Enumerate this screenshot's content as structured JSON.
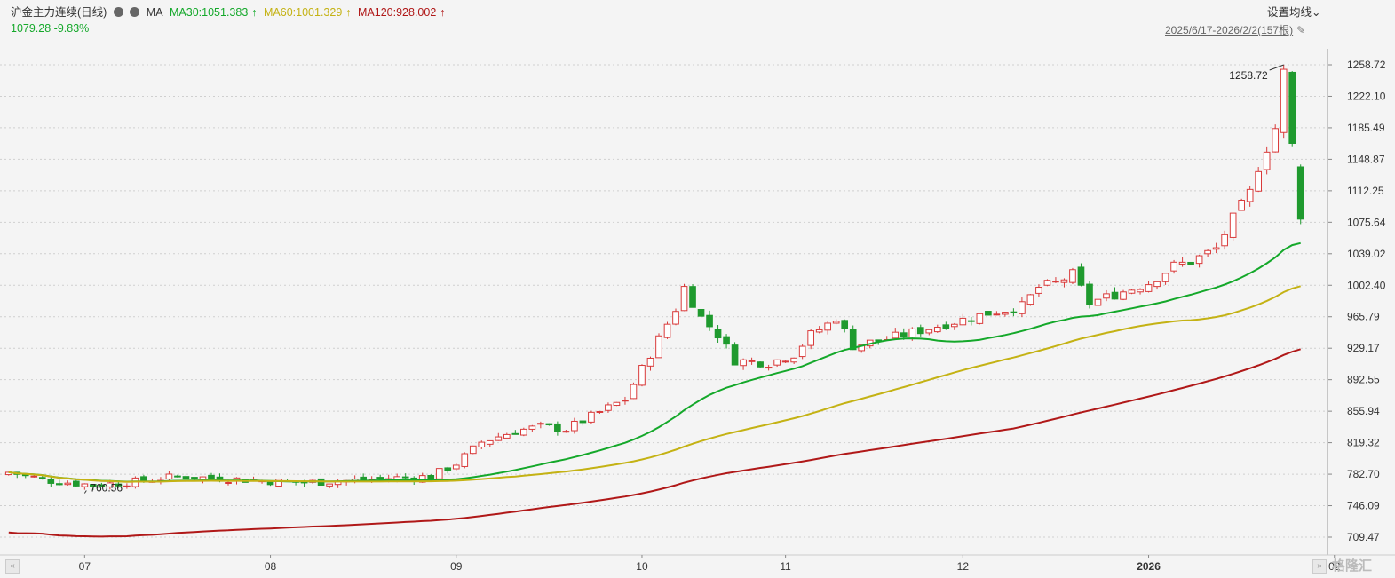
{
  "header": {
    "title": "沪金主力连续(日线)",
    "ma_label": "MA",
    "ma30": "MA30:1051.383",
    "ma60": "MA60:1001.329",
    "ma120": "MA120:928.002",
    "up_arrow": "↑",
    "price_change": "1079.28 -9.83%",
    "settings_label": "设置均线",
    "settings_caret": "⌄",
    "range_label": "2025/6/17-2026/2/2(157根)",
    "pin_icon": "pin-icon"
  },
  "colors": {
    "up": "#d93a3a",
    "down": "#1f9a2e",
    "ma30": "#14a82a",
    "ma60": "#c4b214",
    "ma120": "#b01818",
    "grid": "#cfcfcf"
  },
  "chart_data": {
    "type": "candlestick",
    "x_range": [
      "2025/6/17",
      "2026/2/2"
    ],
    "bar_count": 157,
    "y_ticks": [
      1258.72,
      1222.1,
      1185.49,
      1148.87,
      1112.25,
      1075.64,
      1039.02,
      1002.4,
      965.79,
      929.17,
      892.55,
      855.94,
      819.32,
      782.7,
      746.09,
      709.47
    ],
    "y_tick_labels": [
      "1258.72",
      "1222.10",
      "1185.49",
      "1148.87",
      "1112.25",
      "1075.64",
      "1039.02",
      "1002.40",
      "965.79",
      "929.17",
      "892.55",
      "855.94",
      "819.32",
      "782.70",
      "746.09",
      "709.47"
    ],
    "ylim": [
      709.47,
      1258.72
    ],
    "x_tick_labels": [
      {
        "label": "07",
        "bar": 9
      },
      {
        "label": "08",
        "bar": 31
      },
      {
        "label": "09",
        "bar": 53
      },
      {
        "label": "10",
        "bar": 75
      },
      {
        "label": "11",
        "bar": 92
      },
      {
        "label": "12",
        "bar": 113
      },
      {
        "label": "2026",
        "bar": 135
      },
      {
        "label": "02",
        "bar": 157
      }
    ],
    "annotations": [
      {
        "text": "1258.72",
        "bar": 151,
        "value": 1258.72
      },
      {
        "text": "760.56",
        "bar": 9,
        "value": 760.56
      }
    ],
    "ma_levels_last": {
      "MA30": 1051.383,
      "MA60": 1001.329,
      "MA120": 928.002
    },
    "close_last": 1079.28,
    "change_last_pct": -9.83,
    "key_path": [
      [
        0,
        785
      ],
      [
        5,
        775
      ],
      [
        10,
        770
      ],
      [
        15,
        774
      ],
      [
        20,
        780
      ],
      [
        25,
        778
      ],
      [
        30,
        775
      ],
      [
        35,
        773
      ],
      [
        40,
        775
      ],
      [
        45,
        778
      ],
      [
        50,
        780
      ],
      [
        53,
        795
      ],
      [
        56,
        820
      ],
      [
        60,
        833
      ],
      [
        63,
        838
      ],
      [
        66,
        835
      ],
      [
        70,
        855
      ],
      [
        73,
        870
      ],
      [
        75,
        905
      ],
      [
        77,
        940
      ],
      [
        79,
        975
      ],
      [
        80,
        1000
      ],
      [
        82,
        965
      ],
      [
        84,
        945
      ],
      [
        86,
        915
      ],
      [
        90,
        912
      ],
      [
        93,
        922
      ],
      [
        95,
        945
      ],
      [
        97,
        957
      ],
      [
        98,
        965
      ],
      [
        100,
        932
      ],
      [
        104,
        940
      ],
      [
        108,
        950
      ],
      [
        112,
        960
      ],
      [
        116,
        970
      ],
      [
        120,
        978
      ],
      [
        122,
        1000
      ],
      [
        124,
        1005
      ],
      [
        126,
        1015
      ],
      [
        128,
        982
      ],
      [
        132,
        995
      ],
      [
        135,
        1005
      ],
      [
        138,
        1025
      ],
      [
        140,
        1030
      ],
      [
        143,
        1045
      ],
      [
        145,
        1080
      ],
      [
        147,
        1110
      ],
      [
        148,
        1140
      ],
      [
        150,
        1185
      ],
      [
        151,
        1250
      ],
      [
        152,
        1165
      ],
      [
        153,
        1079.28
      ]
    ]
  },
  "nav": {
    "prev": "«",
    "next": "»"
  },
  "watermark": "格隆汇"
}
